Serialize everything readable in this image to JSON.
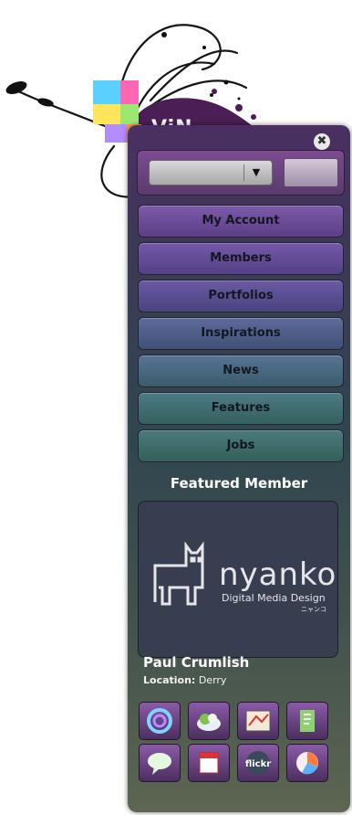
{
  "header": {
    "logo_text": "ViN",
    "close_glyph": "✖"
  },
  "search": {
    "dropdown_value": "",
    "dropdown_arrow": "▼",
    "go_label": ""
  },
  "nav": {
    "items": [
      {
        "label": "My Account"
      },
      {
        "label": "Members"
      },
      {
        "label": "Portfolios"
      },
      {
        "label": "Inspirations"
      },
      {
        "label": "News"
      },
      {
        "label": "Features"
      },
      {
        "label": "Jobs"
      }
    ]
  },
  "featured": {
    "title": "Featured Member",
    "logo_name": "nyanko",
    "logo_tagline": "Digital Media Design",
    "logo_kana": "ニャンコ",
    "name": "Paul Crumlish",
    "location_label": "Location:",
    "location_value": "Derry"
  },
  "social_icons": [
    {
      "icon": "swirl-icon"
    },
    {
      "icon": "cloud-icon"
    },
    {
      "icon": "map-icon"
    },
    {
      "icon": "bookmark-icon"
    },
    {
      "icon": "chat-bubble-icon"
    },
    {
      "icon": "calendar-icon"
    },
    {
      "icon": "flickr-icon",
      "text": "flickr"
    },
    {
      "icon": "pie-chart-icon"
    }
  ],
  "colors": {
    "panel_purple": "#4a2f62",
    "panel_green": "#5c6652",
    "nav_purple": "#6e4d9a",
    "nav_teal": "#3f6d6e",
    "text_dark": "#13171f"
  }
}
